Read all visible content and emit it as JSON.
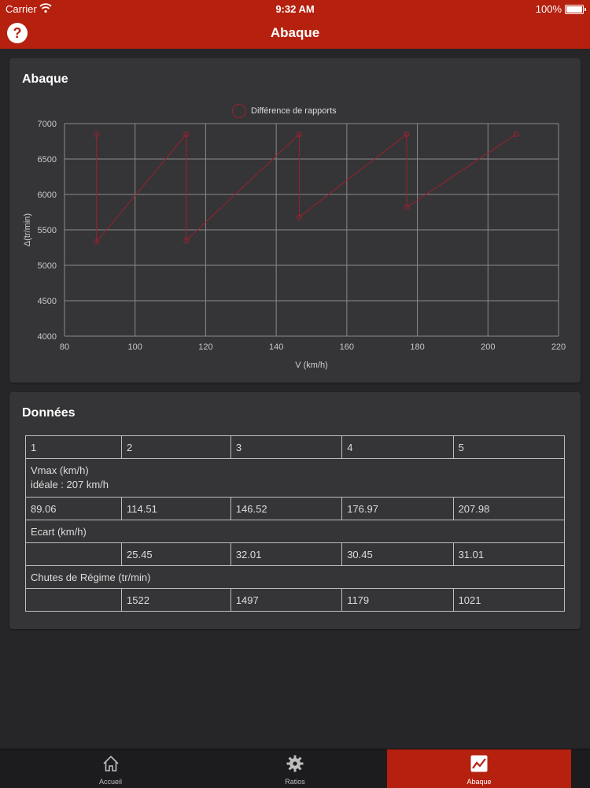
{
  "status": {
    "carrier": "Carrier",
    "time": "9:32 AM",
    "battery": "100%"
  },
  "nav": {
    "title": "Abaque",
    "help_label": "?"
  },
  "abaque_card": {
    "title": "Abaque"
  },
  "chart_data": {
    "type": "line",
    "title": "",
    "legend": [
      "Différence de rapports"
    ],
    "legend_position": "top-center",
    "xlabel": "V (km/h)",
    "ylabel": "Δ(tr/min)",
    "xlim": [
      80,
      220
    ],
    "ylim": [
      4000,
      7000
    ],
    "xticks": [
      80,
      100,
      120,
      140,
      160,
      180,
      200,
      220
    ],
    "yticks": [
      4000,
      4500,
      5000,
      5500,
      6000,
      6500,
      7000
    ],
    "grid": true,
    "series": [
      {
        "name": "Différence de rapports",
        "color": "#9c2030",
        "x": [
          89.06,
          89.06,
          114.51,
          114.51,
          146.52,
          146.52,
          176.97,
          176.97,
          207.98
        ],
        "y": [
          6850,
          5330,
          6850,
          5350,
          6850,
          5680,
          6850,
          5820,
          6850
        ]
      }
    ]
  },
  "donnees_card": {
    "title": "Données",
    "header": [
      "1",
      "2",
      "3",
      "4",
      "5"
    ],
    "vmax_label": "Vmax (km/h)",
    "vmax_sub": "idéale : 207 km/h",
    "vmax": [
      "89.06",
      "114.51",
      "146.52",
      "176.97",
      "207.98"
    ],
    "ecart_label": "Ecart (km/h)",
    "ecart": [
      "",
      "25.45",
      "32.01",
      "30.45",
      "31.01"
    ],
    "chutes_label": "Chutes de Régime (tr/min)",
    "chutes": [
      "",
      "1522",
      "1497",
      "1179",
      "1021"
    ]
  },
  "tabs": [
    {
      "label": "Accueil",
      "icon": "home-icon",
      "active": false
    },
    {
      "label": "Ratios",
      "icon": "gear-icon",
      "active": false
    },
    {
      "label": "Abaque",
      "icon": "chart-icon",
      "active": true
    }
  ],
  "colors": {
    "accent": "#b5200f",
    "series": "#9c2030",
    "background": "#262628",
    "card": "#353537"
  }
}
